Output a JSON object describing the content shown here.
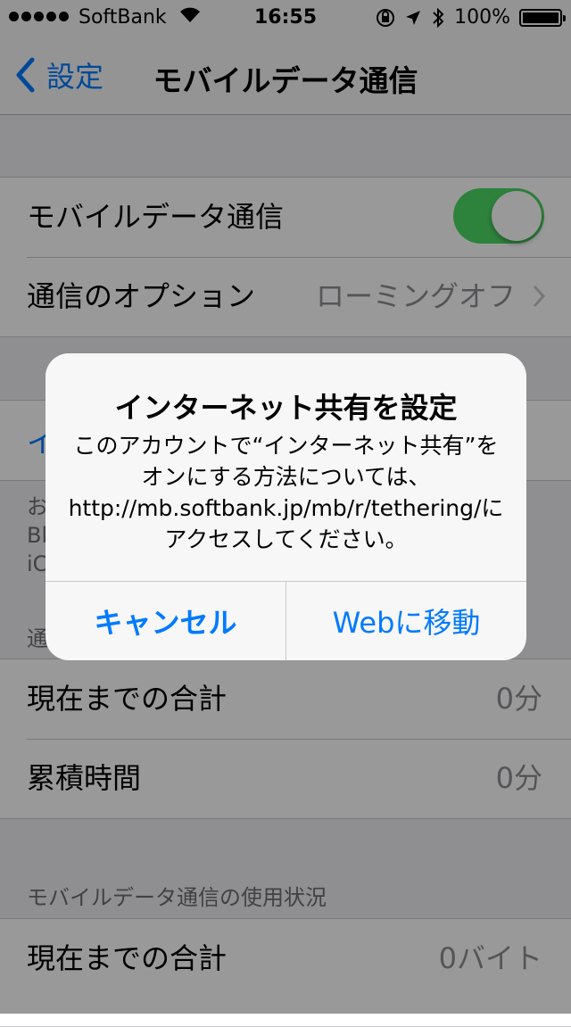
{
  "status_bar": {
    "carrier": "SoftBank",
    "time": "16:55",
    "battery": "100%",
    "icons": [
      "signal-icon",
      "wifi-icon",
      "orientation-lock-icon",
      "location-icon",
      "bluetooth-icon",
      "battery-icon"
    ]
  },
  "nav": {
    "back_label": "設定",
    "title": "モバイルデータ通信"
  },
  "cellular": {
    "mobile_data_label": "モバイルデータ通信",
    "mobile_data_on": true,
    "options_label": "通信のオプション",
    "options_value": "ローミングオフ"
  },
  "tethering": {
    "link_partial": "イ",
    "footer_lines": [
      "お",
      "Bl",
      "iC"
    ]
  },
  "call_time": {
    "header_partial": "通",
    "rows": [
      {
        "label": "現在までの合計",
        "value": "0分"
      },
      {
        "label": "累積時間",
        "value": "0分"
      }
    ]
  },
  "usage": {
    "header": "モバイルデータ通信の使用状況",
    "rows": [
      {
        "label": "現在までの合計",
        "value": "0バイト"
      }
    ]
  },
  "alert": {
    "title": "インターネット共有を設定",
    "message": "このアカウントで“インターネット共有”をオンにする方法については、http://mb.softbank.jp/mb/r/tethering/にアクセスしてください。",
    "cancel_label": "キャンセル",
    "web_label": "Webに移動"
  },
  "colors": {
    "accent": "#007aff",
    "toggle_on": "#4cd964",
    "background": "#efeff4"
  }
}
